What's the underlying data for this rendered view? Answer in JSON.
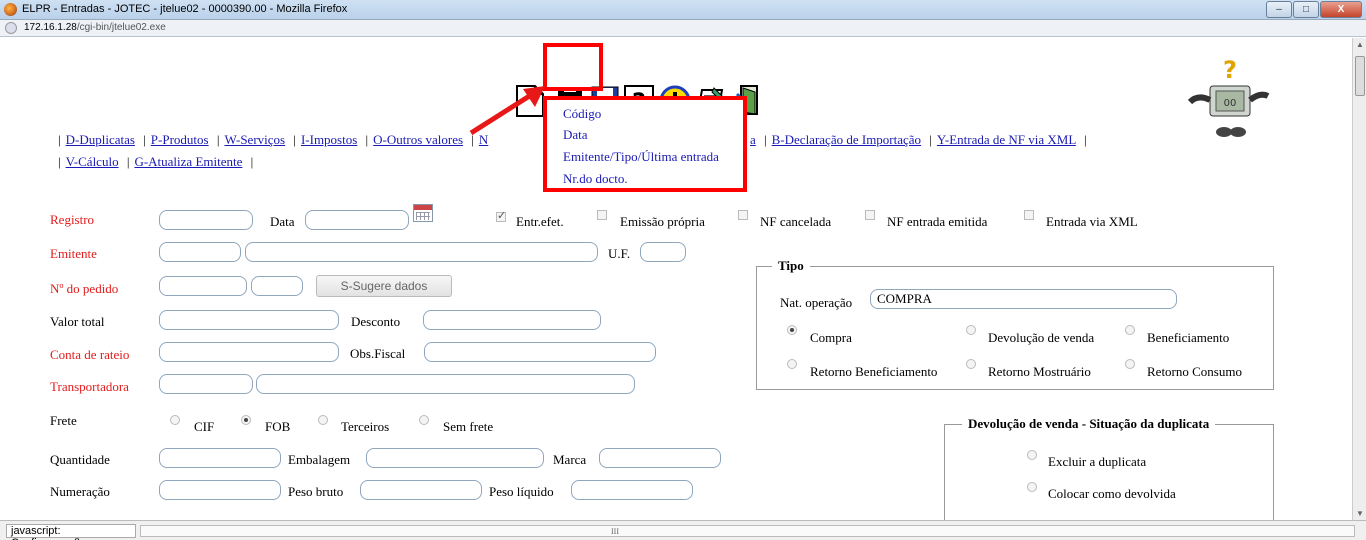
{
  "window": {
    "title": "ELPR - Entradas - JOTEC - jtelue02 - 0000390.00 - Mozilla Firefox",
    "url_host": "172.16.1.28",
    "url_path": "/cgi-bin/jtelue02.exe",
    "minimize": "–",
    "maximize": "□",
    "close": "X"
  },
  "toolbar": {
    "icons": [
      "new-document-icon",
      "binoculars-search-icon",
      "save-floppy-icon",
      "help-question-icon",
      "warning-exclamation-icon",
      "notepad-icon",
      "exit-door-icon"
    ]
  },
  "search_menu": {
    "items": [
      "Código",
      "Data",
      "Emitente/Tipo/Última entrada",
      "Nr.do docto."
    ]
  },
  "links": {
    "row1": [
      "D-Duplicatas",
      "P-Produtos",
      "W-Serviços",
      "I-Impostos",
      "O-Outros valores",
      "B-Declaração de Importação",
      "Y-Entrada de NF via XML"
    ],
    "row1_hidden_fragment": "N",
    "row1_partial": "a",
    "row2": [
      "V-Cálculo",
      "G-Atualiza Emitente"
    ],
    "sep": "|"
  },
  "form": {
    "registro": "Registro",
    "data": "Data",
    "entr_efet": "Entr.efet.",
    "emissao_propria": "Emissão própria",
    "nf_cancelada": "NF cancelada",
    "nf_entrada_emitida": "NF entrada emitida",
    "entrada_via_xml": "Entrada via XML",
    "emitente": "Emitente",
    "uf": "U.F.",
    "pedido": "Nº do pedido",
    "sugere_button": "S-Sugere dados",
    "valor_total": "Valor total",
    "desconto": "Desconto",
    "conta_rateio": "Conta de rateio",
    "obs_fiscal": "Obs.Fiscal",
    "transportadora": "Transportadora",
    "frete": "Frete",
    "frete_options": [
      "CIF",
      "FOB",
      "Terceiros",
      "Sem frete"
    ],
    "frete_selected": "FOB",
    "quantidade": "Quantidade",
    "embalagem": "Embalagem",
    "marca": "Marca",
    "numeracao": "Numeração",
    "peso_bruto": "Peso bruto",
    "peso_liquido": "Peso líquido"
  },
  "tipo": {
    "legend": "Tipo",
    "nat_operacao_label": "Nat. operação",
    "nat_operacao_value": "COMPRA",
    "options": [
      "Compra",
      "Devolução de venda",
      "Beneficiamento",
      "Retorno Beneficiamento",
      "Retorno Mostruário",
      "Retorno Consumo"
    ],
    "selected": "Compra"
  },
  "devolucao": {
    "legend": "Devolução de venda - Situação da duplicata",
    "options": [
      "Excluir a duplicata",
      "Colocar como devolvida"
    ]
  },
  "status": {
    "text": "javascript: Confirmacao();",
    "hscroll_grip": "III"
  }
}
